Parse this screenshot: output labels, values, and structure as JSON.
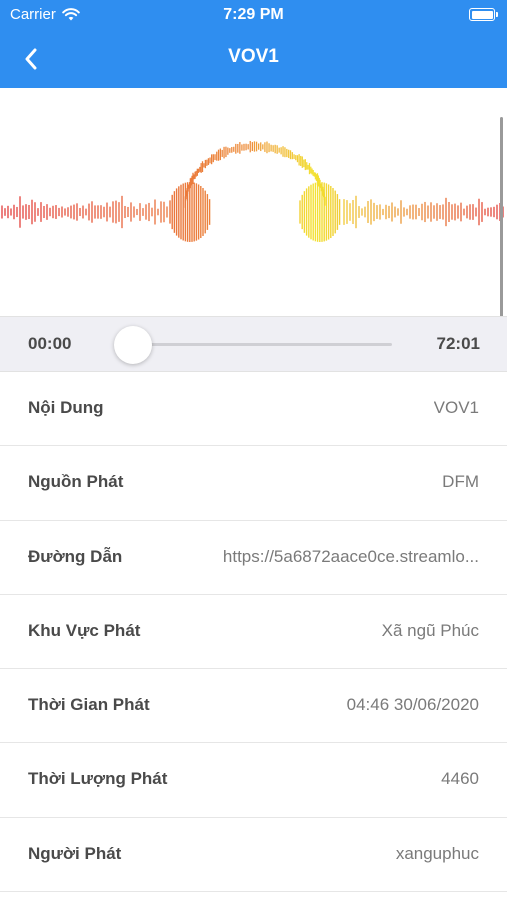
{
  "status_bar": {
    "carrier": "Carrier",
    "time": "7:29 PM"
  },
  "nav": {
    "title": "VOV1",
    "back_icon": "chevron-left-icon"
  },
  "player": {
    "current_time": "00:00",
    "duration": "72:01",
    "progress": 0.0
  },
  "details": [
    {
      "label": "Nội Dung",
      "value": "VOV1"
    },
    {
      "label": "Nguồn Phát",
      "value": "DFM"
    },
    {
      "label": "Đường Dẫn",
      "value": "https://5a6872aace0ce.streamlo..."
    },
    {
      "label": "Khu Vực Phát",
      "value": "Xã ngũ Phúc"
    },
    {
      "label": "Thời Gian Phát",
      "value": "04:46 30/06/2020"
    },
    {
      "label": "Thời Lượng Phát",
      "value": "4460"
    },
    {
      "label": "Người Phát",
      "value": "xanguphuc"
    }
  ],
  "colors": {
    "header": "#2f8ef0",
    "wave_red": "#e23b3b",
    "wave_orange": "#ef9a3c",
    "wave_yellow": "#f3e233"
  }
}
